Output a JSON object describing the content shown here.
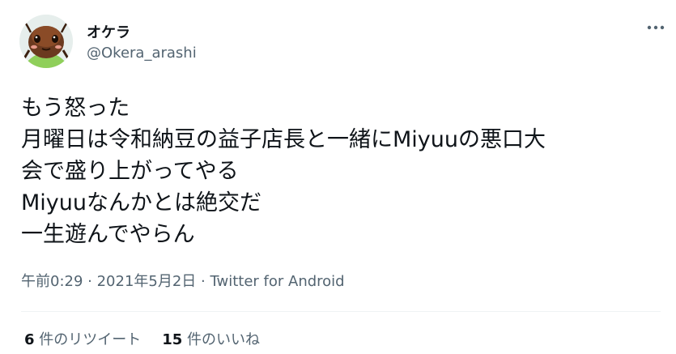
{
  "user": {
    "display_name": "オケラ",
    "handle": "@Okera_arashi",
    "avatar_icon": "cricket-avatar-icon"
  },
  "tweet": {
    "lines": [
      "もう怒った",
      "月曜日は令和納豆の益子店長と一緒にMiyuuの悪口大",
      "会で盛り上がってやる",
      "Miyuuなんかとは絶交だ",
      "一生遊んでやらん"
    ],
    "time": "午前0:29",
    "separator": " · ",
    "date": "2021年5月2日",
    "source": "Twitter for Android"
  },
  "stats": {
    "retweets_count": "6",
    "retweets_label": " 件のリツイート",
    "likes_count": "15",
    "likes_label": " 件のいいね"
  },
  "colors": {
    "text": "#0f1419",
    "secondary": "#536471",
    "divider": "#eff3f4"
  }
}
